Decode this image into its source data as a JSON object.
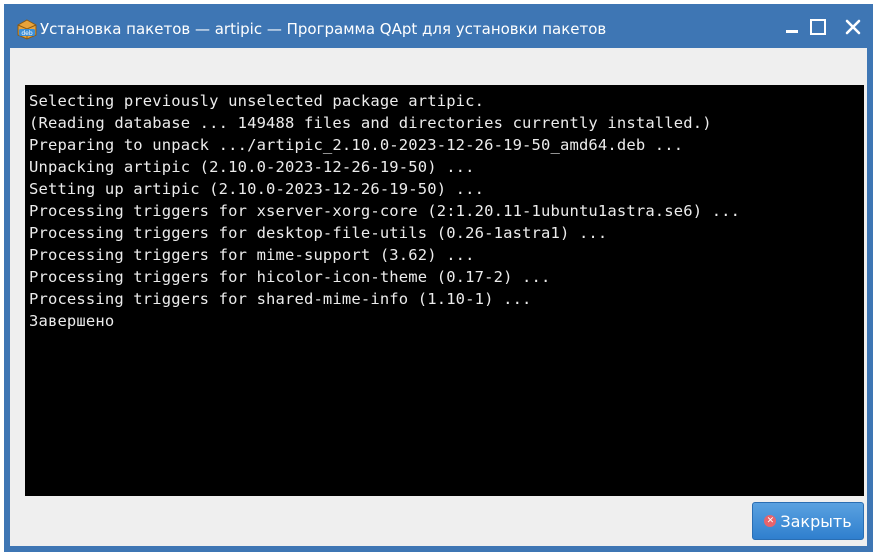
{
  "window": {
    "title": "Установка пакетов — artipic — Программа QApt для установки пакетов",
    "app_icon": "deb-package-icon",
    "controls": {
      "minimize_icon": "minimize-icon",
      "maximize_icon": "maximize-icon",
      "close_icon": "close-icon"
    }
  },
  "terminal": {
    "lines": [
      "Selecting previously unselected package artipic.",
      "(Reading database ... 149488 files and directories currently installed.)",
      "Preparing to unpack .../artipic_2.10.0-2023-12-26-19-50_amd64.deb ...",
      "Unpacking artipic (2.10.0-2023-12-26-19-50) ...",
      "Setting up artipic (2.10.0-2023-12-26-19-50) ...",
      "Processing triggers for xserver-xorg-core (2:1.20.11-1ubuntu1astra.se6) ...",
      "Processing triggers for desktop-file-utils (0.26-1astra1) ...",
      "Processing triggers for mime-support (3.62) ...",
      "Processing triggers for hicolor-icon-theme (0.17-2) ...",
      "Processing triggers for shared-mime-info (1.10-1) ...",
      "Завершено"
    ]
  },
  "footer": {
    "close_label": "Закрыть",
    "close_icon": "close-circle-icon"
  },
  "colors": {
    "titlebar": "#3e76b4",
    "client_bg": "#efefef",
    "terminal_bg": "#000000",
    "terminal_text": "#ececec",
    "button_accent": "#2f7fce"
  }
}
